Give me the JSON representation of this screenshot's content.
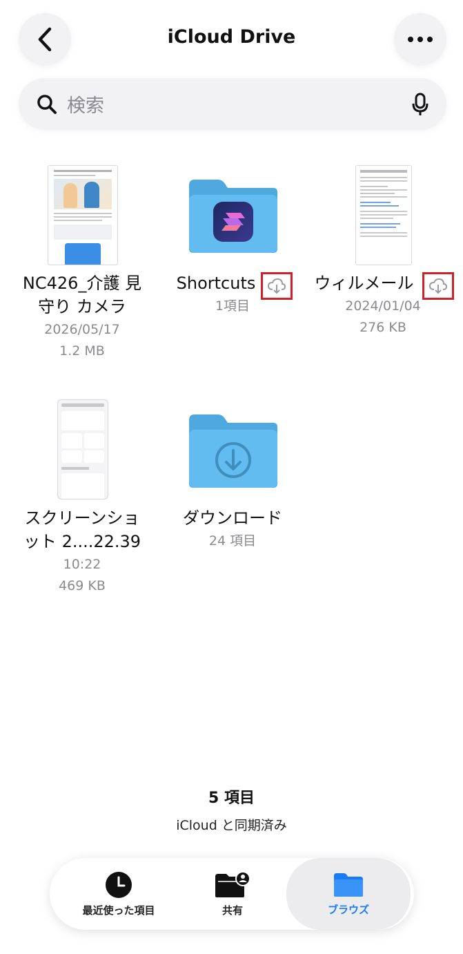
{
  "header": {
    "title": "iCloud Drive"
  },
  "search": {
    "placeholder": "検索"
  },
  "items": [
    {
      "name_line1": "NC426_介護 見",
      "name_line2": "守り カメラ",
      "date": "2026/05/17",
      "size": "1.2 MB"
    },
    {
      "name": "Shortcuts",
      "meta": "1項目"
    },
    {
      "name": "ウィルメール",
      "date": "2024/01/04",
      "size": "276 KB"
    },
    {
      "name_line1": "スクリーンショ",
      "name_line2": "ット 2....22.39",
      "date": "10:22",
      "size": "469 KB"
    },
    {
      "name": "ダウンロード",
      "meta": "24 項目"
    }
  ],
  "footer": {
    "count": "5 項目",
    "sync_status": "iCloud と同期済み"
  },
  "tabs": [
    {
      "label": "最近使った項目",
      "icon": "clock-icon"
    },
    {
      "label": "共有",
      "icon": "shared-folder-icon"
    },
    {
      "label": "ブラウズ",
      "icon": "folder-icon",
      "active": true
    }
  ],
  "colors": {
    "accent": "#1a7cf5",
    "folder": "#5ab8ec",
    "highlight_box": "#d0202a"
  }
}
